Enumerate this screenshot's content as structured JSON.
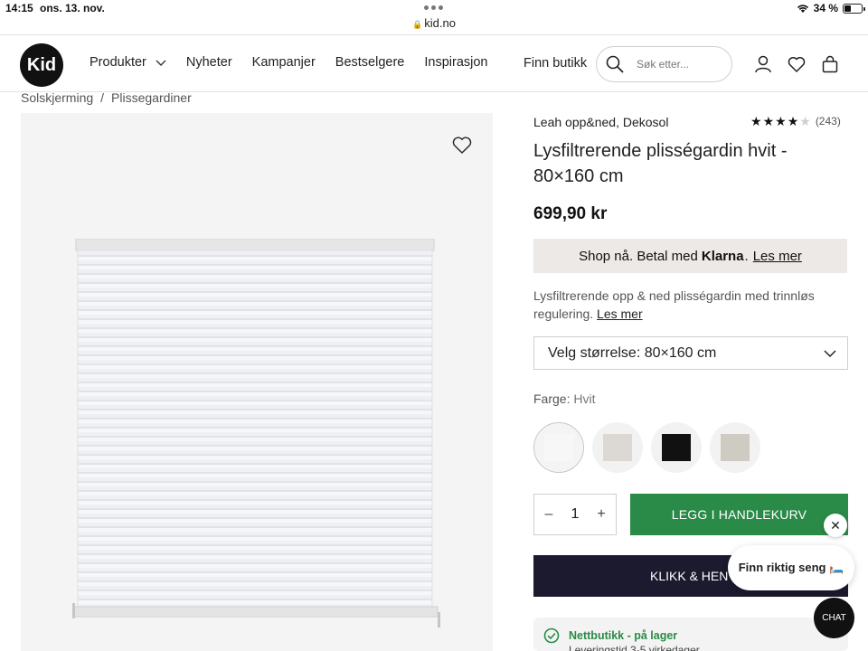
{
  "status_bar": {
    "time": "14:15",
    "date": "ons. 13. nov.",
    "battery": "34 %",
    "battery_level": 0.34
  },
  "browser": {
    "url": "kid.no"
  },
  "header": {
    "logo": "Kid",
    "nav": [
      "Produkter",
      "Nyheter",
      "Kampanjer",
      "Bestselgere",
      "Inspirasjon"
    ],
    "find_store": "Finn butikk",
    "search_placeholder": "Søk etter..."
  },
  "breadcrumb": {
    "items": [
      "Solskjerming",
      "Plissegardiner"
    ],
    "separator": "/"
  },
  "product": {
    "brand": "Leah opp&ned, Dekosol",
    "rating": {
      "stars": 4,
      "max": 5,
      "count": "(243)"
    },
    "title": "Lysfiltrerende plisségardin hvit - 80×160 cm",
    "price": "699,90 kr",
    "klarna": {
      "prefix": "Shop nå. Betal med",
      "brand": "Klarna",
      "suffix": ".",
      "link": "Les mer"
    },
    "description": "Lysfiltrerende opp & ned plisségardin med trinnløs regulering.",
    "description_link": "Les mer",
    "size_select": "Velg størrelse: 80×160 cm",
    "color_label": "Farge:",
    "color_value": "Hvit",
    "swatches": [
      {
        "name": "white",
        "color": "#f7f7f7",
        "selected": true
      },
      {
        "name": "light-grey",
        "color": "#dcd8d4",
        "selected": false
      },
      {
        "name": "black",
        "color": "#111111",
        "selected": false
      },
      {
        "name": "beige-grey",
        "color": "#cfcbc3",
        "selected": false
      }
    ],
    "quantity": "1",
    "qty_minus": "–",
    "qty_plus": "+",
    "add_to_cart": "LEGG I HANDLEKURV",
    "click_collect": "KLIKK & HENT",
    "stock_title": "Nettbutikk - på lager",
    "stock_sub": "Leveringstid 3-5 virkedager"
  },
  "overlays": {
    "close": "✕",
    "bubble": "Finn riktig seng 🛏️",
    "chat": "CHAT"
  },
  "colors": {
    "accent_green": "#2a8a47",
    "dark_navy": "#1b1a2e",
    "klarna_bg": "#ece9e6"
  }
}
